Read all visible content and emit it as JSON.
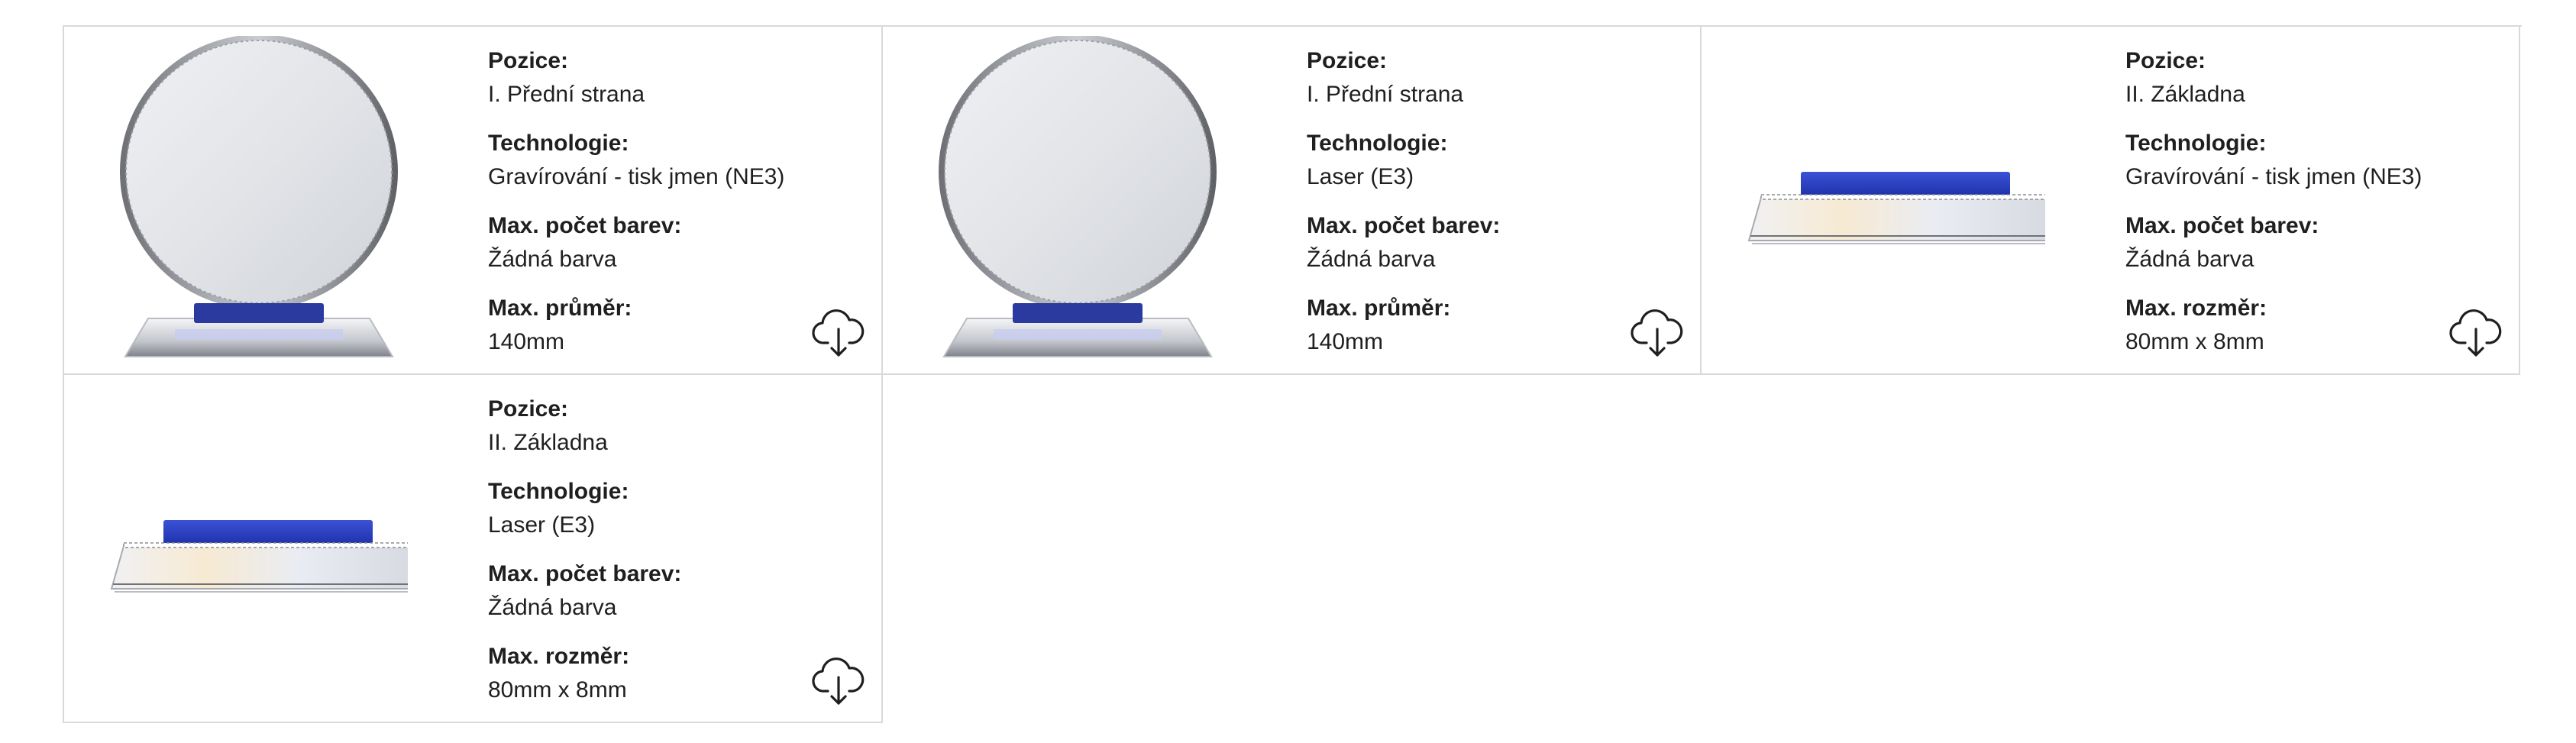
{
  "cards": [
    {
      "image": "round-crystal-award-front",
      "labels": [
        "Pozice:",
        "Technologie:",
        "Max. počet barev:",
        "Max. průměr:"
      ],
      "values": [
        "I. Přední strana",
        "Gravírování - tisk jmen (NE3)",
        "Žádná barva",
        "140mm"
      ],
      "icon": "cloud-download-icon"
    },
    {
      "image": "round-crystal-award-front",
      "labels": [
        "Pozice:",
        "Technologie:",
        "Max. počet barev:",
        "Max. průměr:"
      ],
      "values": [
        "I. Přední strana",
        "Laser (E3)",
        "Žádná barva",
        "140mm"
      ],
      "icon": "cloud-download-icon"
    },
    {
      "image": "crystal-award-base",
      "labels": [
        "Pozice:",
        "Technologie:",
        "Max. počet barev:",
        "Max. rozměr:"
      ],
      "values": [
        "II. Základna",
        "Gravírování - tisk jmen (NE3)",
        "Žádná barva",
        "80mm x 8mm"
      ],
      "icon": "cloud-download-icon"
    },
    {
      "image": "crystal-award-base",
      "labels": [
        "Pozice:",
        "Technologie:",
        "Max. počet barev:",
        "Max. rozměr:"
      ],
      "values": [
        "II. Základna",
        "Laser (E3)",
        "Žádná barva",
        "80mm x 8mm"
      ],
      "icon": "cloud-download-icon"
    }
  ],
  "colors": {
    "border": "#d9d9d9",
    "text": "#1f1f1f",
    "base_blue": "#2440c8"
  }
}
